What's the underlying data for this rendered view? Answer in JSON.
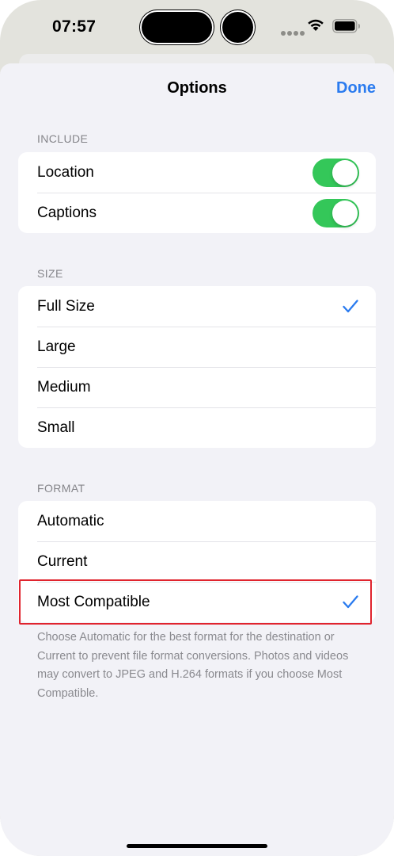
{
  "status_bar": {
    "time": "07:57"
  },
  "nav": {
    "title": "Options",
    "done_label": "Done"
  },
  "include": {
    "header": "INCLUDE",
    "items": [
      {
        "label": "Location",
        "on": true
      },
      {
        "label": "Captions",
        "on": true
      }
    ]
  },
  "size": {
    "header": "SIZE",
    "items": [
      {
        "label": "Full Size",
        "selected": true
      },
      {
        "label": "Large",
        "selected": false
      },
      {
        "label": "Medium",
        "selected": false
      },
      {
        "label": "Small",
        "selected": false
      }
    ]
  },
  "format": {
    "header": "FORMAT",
    "items": [
      {
        "label": "Automatic",
        "selected": false
      },
      {
        "label": "Current",
        "selected": false
      },
      {
        "label": "Most Compatible",
        "selected": true
      }
    ],
    "footer": "Choose Automatic for the best format for the destination or Current to prevent file format conversions. Photos and videos may convert to JPEG and H.264 formats if you choose Most Compatible."
  },
  "colors": {
    "accent": "#2a7bef",
    "toggle_on": "#34c759",
    "highlight": "#e0242e"
  },
  "icons": {
    "checkmark": "checkmark-icon",
    "wifi": "wifi-icon",
    "battery": "battery-icon",
    "signal": "signal-dots-icon"
  }
}
